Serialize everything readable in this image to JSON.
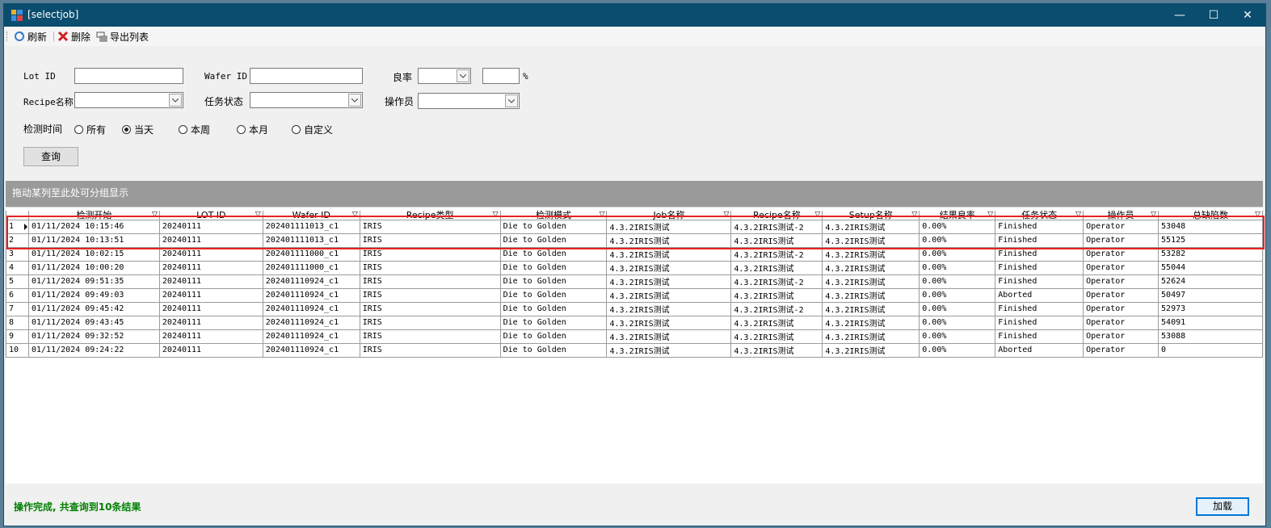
{
  "window": {
    "title": "[selectjob]",
    "minimize": "—",
    "maximize": "☐",
    "close": "✕"
  },
  "toolbar": {
    "refresh": "刷新",
    "delete": "删除",
    "export": "导出列表"
  },
  "filters": {
    "lot_id_label": "Lot ID",
    "wafer_id_label": "Wafer ID",
    "yield_label": "良率",
    "percent_sign": "%",
    "recipe_label": "Recipe名称",
    "task_status_label": "任务状态",
    "operator_label": "操作员",
    "time_label": "检测时间",
    "time_options": [
      "所有",
      "当天",
      "本周",
      "本月",
      "自定义"
    ],
    "time_selected": "当天",
    "query_button": "查询"
  },
  "group_band": "拖动某列至此处可分组显示",
  "grid": {
    "columns": [
      "检测开始",
      "LOT ID",
      "Wafer ID",
      "Recipe类型",
      "检测模式",
      "Job名称",
      "Recipe名称",
      "Setup名称",
      "结果良率",
      "任务状态",
      "操作员",
      "总缺陷数"
    ],
    "rows": [
      [
        "1",
        "01/11/2024 10:15:46",
        "20240111",
        "202401111013_c1",
        "IRIS",
        "Die to Golden",
        "4.3.2IRIS测试",
        "4.3.2IRIS测试-2",
        "4.3.2IRIS测试",
        "0.00%",
        "Finished",
        "Operator",
        "53048"
      ],
      [
        "2",
        "01/11/2024 10:13:51",
        "20240111",
        "202401111013_c1",
        "IRIS",
        "Die to Golden",
        "4.3.2IRIS测试",
        "4.3.2IRIS测试",
        "4.3.2IRIS测试",
        "0.00%",
        "Finished",
        "Operator",
        "55125"
      ],
      [
        "3",
        "01/11/2024 10:02:15",
        "20240111",
        "202401111000_c1",
        "IRIS",
        "Die to Golden",
        "4.3.2IRIS测试",
        "4.3.2IRIS测试-2",
        "4.3.2IRIS测试",
        "0.00%",
        "Finished",
        "Operator",
        "53282"
      ],
      [
        "4",
        "01/11/2024 10:00:20",
        "20240111",
        "202401111000_c1",
        "IRIS",
        "Die to Golden",
        "4.3.2IRIS测试",
        "4.3.2IRIS测试",
        "4.3.2IRIS测试",
        "0.00%",
        "Finished",
        "Operator",
        "55044"
      ],
      [
        "5",
        "01/11/2024 09:51:35",
        "20240111",
        "202401110924_c1",
        "IRIS",
        "Die to Golden",
        "4.3.2IRIS测试",
        "4.3.2IRIS测试-2",
        "4.3.2IRIS测试",
        "0.00%",
        "Finished",
        "Operator",
        "52624"
      ],
      [
        "6",
        "01/11/2024 09:49:03",
        "20240111",
        "202401110924_c1",
        "IRIS",
        "Die to Golden",
        "4.3.2IRIS测试",
        "4.3.2IRIS测试",
        "4.3.2IRIS测试",
        "0.00%",
        "Aborted",
        "Operator",
        "50497"
      ],
      [
        "7",
        "01/11/2024 09:45:42",
        "20240111",
        "202401110924_c1",
        "IRIS",
        "Die to Golden",
        "4.3.2IRIS测试",
        "4.3.2IRIS测试-2",
        "4.3.2IRIS测试",
        "0.00%",
        "Finished",
        "Operator",
        "52973"
      ],
      [
        "8",
        "01/11/2024 09:43:45",
        "20240111",
        "202401110924_c1",
        "IRIS",
        "Die to Golden",
        "4.3.2IRIS测试",
        "4.3.2IRIS测试",
        "4.3.2IRIS测试",
        "0.00%",
        "Finished",
        "Operator",
        "54091"
      ],
      [
        "9",
        "01/11/2024 09:32:52",
        "20240111",
        "202401110924_c1",
        "IRIS",
        "Die to Golden",
        "4.3.2IRIS测试",
        "4.3.2IRIS测试",
        "4.3.2IRIS测试",
        "0.00%",
        "Finished",
        "Operator",
        "53088"
      ],
      [
        "10",
        "01/11/2024 09:24:22",
        "20240111",
        "202401110924_c1",
        "IRIS",
        "Die to Golden",
        "4.3.2IRIS测试",
        "4.3.2IRIS测试",
        "4.3.2IRIS测试",
        "0.00%",
        "Aborted",
        "Operator",
        "0"
      ]
    ]
  },
  "status_text": "操作完成, 共查询到10条结果",
  "load_button": "加载",
  "colors": {
    "titlebar": "#0b4d6e",
    "status_ok": "#008000",
    "highlight": "#e52222",
    "group_band": "#9a9a9a"
  }
}
